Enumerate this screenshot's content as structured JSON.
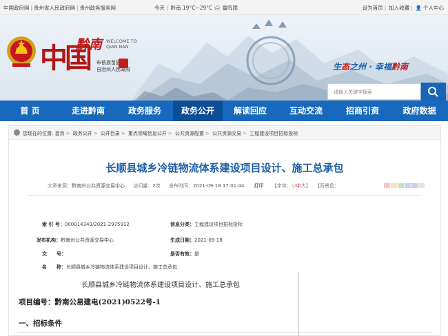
{
  "topbar": {
    "links": [
      "中国政府网",
      "贵州省人民政府网",
      "贵州政务服务网"
    ],
    "weather_label": "今天",
    "date_sep": "|",
    "weather": "黔南 19°C~29°C 🌧 雷阵雨",
    "right": [
      "设为首页",
      "加入收藏",
      "个人中心"
    ]
  },
  "banner": {
    "logo_zh": "中国",
    "logo_qn": "黔南",
    "logo_en_1": "WELCOME TO",
    "logo_en_2": "QIAN NAN",
    "logo_sub_1": "布依族苗族",
    "logo_sub_2": "自治州人民政府",
    "slogan_a": "生",
    "slogan_b": "态",
    "slogan_c": "之州 · 幸福",
    "slogan_d": "黔南",
    "search_placeholder": "请输入关键字搜索"
  },
  "nav": [
    {
      "label": "首 页",
      "active": false
    },
    {
      "label": "走进黔南",
      "active": false
    },
    {
      "label": "政务服务",
      "active": false
    },
    {
      "label": "政务公开",
      "active": true
    },
    {
      "label": "解读回应",
      "active": false
    },
    {
      "label": "互动交流",
      "active": false
    },
    {
      "label": "招商引资",
      "active": false
    },
    {
      "label": "政府数据",
      "active": false
    }
  ],
  "breadcrumb": {
    "prefix": "您现在的位置:",
    "items": [
      "首页",
      "政务公开",
      "公开目录",
      "重点领域信息公开",
      "公共资源配置",
      "公共资源交易",
      "工程建设项目招标投标"
    ]
  },
  "article": {
    "title": "长顺县城乡冷链物流体系建设项目设计、施工总承包",
    "source_label": "文章来源：",
    "source": "黔南州公共资源交易中心",
    "views_label": "访问量：",
    "views": "2次",
    "time_label": "发布时间：",
    "time": "2021-09-18 17:01:44",
    "print": "打印",
    "font_label": "【字体：",
    "font_small": "小",
    "font_mid": "中",
    "font_large": "大",
    "font_close": "】",
    "color_label": "【背景色：",
    "swatches": [
      "#f7c7c7",
      "#f1e7b3",
      "#c9e4c0",
      "#bfd8ef",
      "#d9c8ec",
      "#e3e3e3"
    ],
    "doc_title": "长顺县城乡冷链物流体系建设项目设计、施工总承包",
    "project_no": "项目编号：黔南公易建电(2021)0522号-1",
    "section_1": "一、招标条件"
  },
  "info": {
    "index_label": "索 引 号：",
    "index": "000014349/2021-2975912",
    "category_label": "信息分类：",
    "category": "工程建设项目招标投标",
    "publisher_label": "发布机构：",
    "publisher": "黔南州公共资源交易中心",
    "date_label": "生成日期：",
    "date": "2021-09-18",
    "doc_label": "文　　号：",
    "doc": "",
    "valid_label": "是否有效：",
    "valid": "是",
    "name_label": "名　　称：",
    "name": "长顺县城乡冷链物流体系建设项目设计、施工总承包"
  }
}
